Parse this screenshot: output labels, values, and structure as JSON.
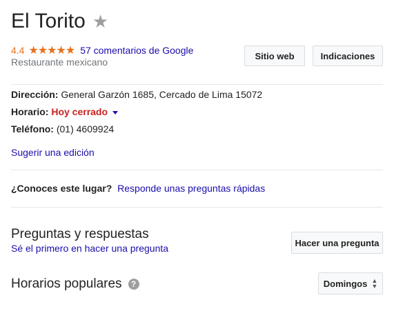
{
  "place": {
    "name": "El Torito",
    "rating": "4.4",
    "stars": "★★★★★",
    "reviews_link": "57 comentarios de Google",
    "category": "Restaurante mexicano"
  },
  "actions": {
    "website": "Sitio web",
    "directions": "Indicaciones"
  },
  "info": {
    "address_label": "Dirección:",
    "address_value": "General Garzón 1685, Cercado de Lima 15072",
    "hours_label": "Horario:",
    "hours_value": "Hoy cerrado",
    "phone_label": "Teléfono:",
    "phone_value": "(01) 4609924"
  },
  "suggest_edit": "Sugerir una edición",
  "know_place": {
    "question": "¿Conoces este lugar?",
    "link": "Responde unas preguntas rápidas"
  },
  "qa": {
    "title": "Preguntas y respuestas",
    "link": "Sé el primero en hacer una pregunta",
    "button": "Hacer una pregunta"
  },
  "popular": {
    "title": "Horarios populares",
    "day": "Domingos"
  },
  "colors": {
    "rating": "#e7711b",
    "link": "#1a0dab",
    "closed": "#c5221f"
  }
}
